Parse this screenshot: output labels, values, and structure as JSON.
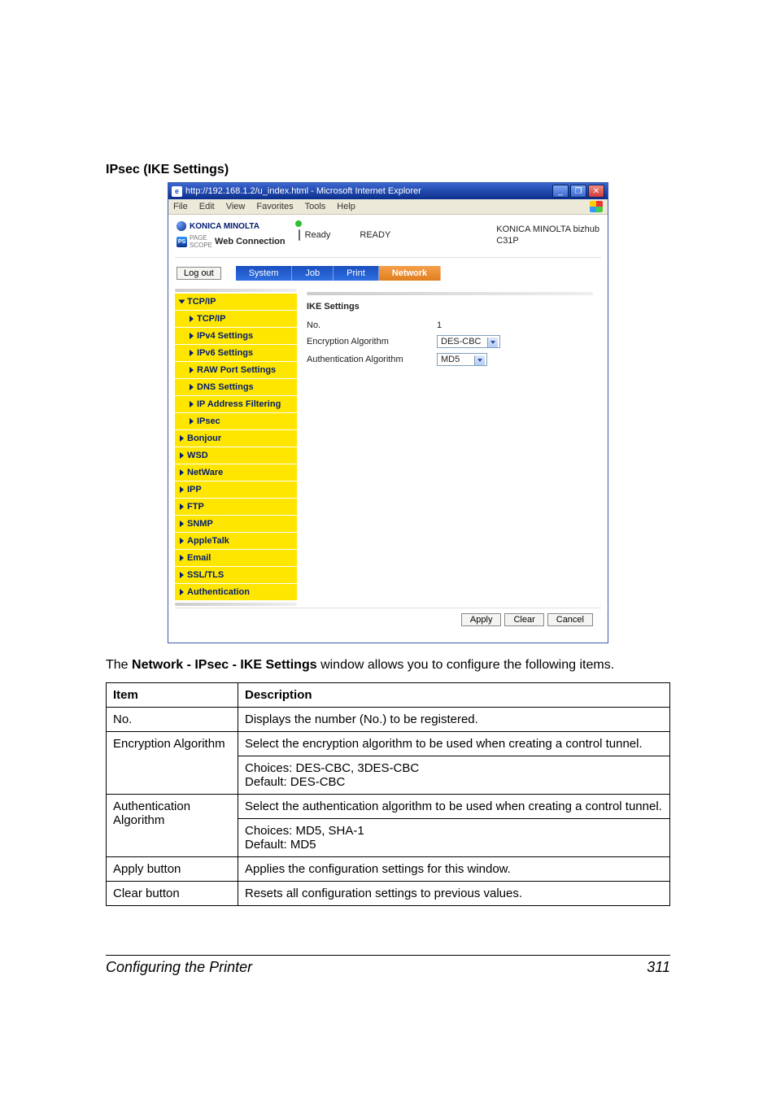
{
  "heading": "IPsec (IKE Settings)",
  "browser": {
    "title": "http://192.168.1.2/u_index.html - Microsoft Internet Explorer",
    "menu": [
      "File",
      "Edit",
      "View",
      "Favorites",
      "Tools",
      "Help"
    ],
    "brand": "KONICA MINOLTA",
    "web_connection": "Web Connection",
    "status_label": "Ready",
    "ready_caps": "READY",
    "model_line1": "KONICA MINOLTA bizhub",
    "model_line2": "C31P",
    "logout": "Log out",
    "tabs": [
      "System",
      "Job",
      "Print",
      "Network"
    ],
    "nav": {
      "tcpip": "TCP/IP",
      "tcpip_sub": "TCP/IP",
      "ipv4": "IPv4 Settings",
      "ipv6": "IPv6 Settings",
      "raw": "RAW Port Settings",
      "dns": "DNS Settings",
      "ipfilter": "IP Address Filtering",
      "ipsec": "IPsec",
      "bonjour": "Bonjour",
      "wsd": "WSD",
      "netware": "NetWare",
      "ipp": "IPP",
      "ftp": "FTP",
      "snmp": "SNMP",
      "appletalk": "AppleTalk",
      "email": "Email",
      "ssltls": "SSL/TLS",
      "auth": "Authentication"
    },
    "panel": {
      "title": "IKE Settings",
      "no_label": "No.",
      "no_value": "1",
      "enc_label": "Encryption Algorithm",
      "enc_value": "DES-CBC",
      "auth_label": "Authentication Algorithm",
      "auth_value": "MD5"
    },
    "buttons": {
      "apply": "Apply",
      "clear": "Clear",
      "cancel": "Cancel"
    }
  },
  "desc_pre": "The ",
  "desc_bold": "Network - IPsec - IKE Settings",
  "desc_post": " window allows you to configure the following items.",
  "spec": {
    "h_item": "Item",
    "h_desc": "Description",
    "rows": [
      {
        "item": "No.",
        "desc": "Displays the number (No.) to be registered."
      },
      {
        "item": "Encryption Algorithm",
        "desc1": "Select the encryption algorithm to be used when creating a control tunnel.",
        "desc2": "Choices: DES-CBC, 3DES-CBC\nDefault:  DES-CBC"
      },
      {
        "item": "Authentication Algorithm",
        "desc1": "Select the authentication algorithm to be used when creating a control tunnel.",
        "desc2": "Choices: MD5, SHA-1\nDefault:  MD5"
      },
      {
        "item": "Apply button",
        "desc": "Applies the configuration settings for this window."
      },
      {
        "item": "Clear button",
        "desc": "Resets all configuration settings to previous values."
      }
    ]
  },
  "footer": {
    "left": "Configuring the Printer",
    "right": "311"
  }
}
